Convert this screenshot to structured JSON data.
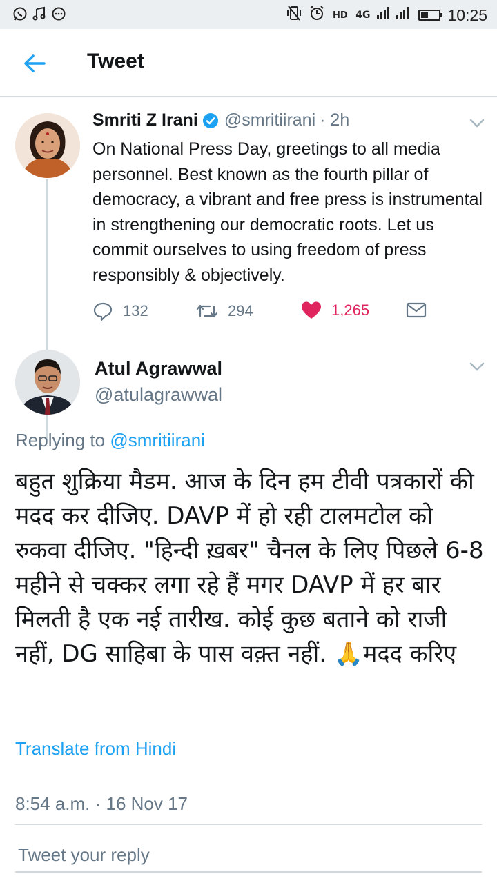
{
  "status_bar": {
    "left_icons": [
      "whatsapp-icon",
      "music-icon",
      "more-icon"
    ],
    "network": "4G",
    "time": "10:25",
    "battery_level": 0.4
  },
  "app_bar": {
    "title": "Tweet"
  },
  "tweet": {
    "author_name": "Smriti Z Irani",
    "handle": "@smritiirani",
    "time_ago": "· 2h",
    "text": "On National Press Day, greetings to all media personnel. Best known as the fourth pillar of democracy, a vibrant and free press is instrumental in strengthening our democratic roots. Let us commit ourselves to using freedom of press responsibly & objectively.",
    "replies": "132",
    "retweets": "294",
    "likes": "1,265",
    "liked": true
  },
  "reply": {
    "author_name": "Atul Agrawwal",
    "handle": "@atulagrawwal",
    "replying_prefix": "Replying to",
    "replying_to": "@smritiirani",
    "text": "बहुत शुक्रिया मैडम. आज के दिन हम टीवी पत्रकारों की मदद कर दीजिए. DAVP में हो रही टालमटोल को रुकवा दीजिए. \"हिन्दी ख़बर\" चैनल के लिए पिछले 6-8 महीने से चक्कर लगा रहे हैं मगर DAVP में हर बार मिलती है एक नई तारीख. कोई कुछ बताने को राजी नहीं, DG साहिबा के पास वक़्त नहीं. 🙏मदद करिए",
    "translate_label": "Translate from Hindi",
    "timestamp": "8:54 a.m. · 16 Nov 17"
  },
  "composer": {
    "placeholder": "Tweet your reply"
  },
  "colors": {
    "accent": "#1da1f2",
    "like": "#e0245e",
    "secondary_text": "#657786"
  }
}
